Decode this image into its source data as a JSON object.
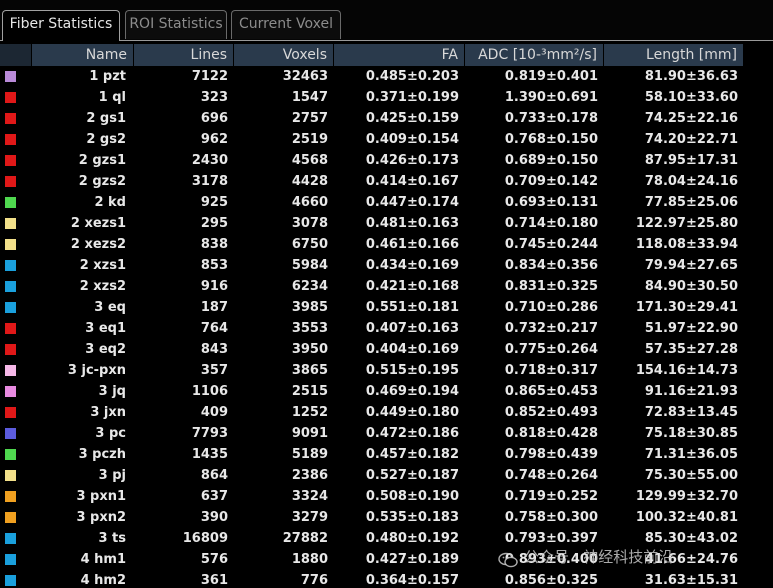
{
  "tabs": [
    {
      "label": "Fiber Statistics",
      "active": true
    },
    {
      "label": "ROI Statistics",
      "active": false
    },
    {
      "label": "Current Voxel",
      "active": false
    }
  ],
  "columns": [
    "Name",
    "Lines",
    "Voxels",
    "FA",
    "ADC  [10-³mm²/s]",
    "Length [mm]"
  ],
  "rows": [
    {
      "color": "#b98ad8",
      "name": "1 pzt",
      "lines": "7122",
      "voxels": "32463",
      "fa": "0.485±0.203",
      "adc": "0.819±0.401",
      "length": "81.90±36.63"
    },
    {
      "color": "#e01818",
      "name": "1 ql",
      "lines": "323",
      "voxels": "1547",
      "fa": "0.371±0.199",
      "adc": "1.390±0.691",
      "length": "58.10±33.60"
    },
    {
      "color": "#e01818",
      "name": "2 gs1",
      "lines": "696",
      "voxels": "2757",
      "fa": "0.425±0.159",
      "adc": "0.733±0.178",
      "length": "74.25±22.16"
    },
    {
      "color": "#e01818",
      "name": "2 gs2",
      "lines": "962",
      "voxels": "2519",
      "fa": "0.409±0.154",
      "adc": "0.768±0.150",
      "length": "74.20±22.71"
    },
    {
      "color": "#e01818",
      "name": "2 gzs1",
      "lines": "2430",
      "voxels": "4568",
      "fa": "0.426±0.173",
      "adc": "0.689±0.150",
      "length": "87.95±17.31"
    },
    {
      "color": "#e01818",
      "name": "2 gzs2",
      "lines": "3178",
      "voxels": "4428",
      "fa": "0.414±0.167",
      "adc": "0.709±0.142",
      "length": "78.04±24.16"
    },
    {
      "color": "#4fd84f",
      "name": "2 kd",
      "lines": "925",
      "voxels": "4660",
      "fa": "0.447±0.174",
      "adc": "0.693±0.131",
      "length": "77.85±25.06"
    },
    {
      "color": "#f2e08a",
      "name": "2 xezs1",
      "lines": "295",
      "voxels": "3078",
      "fa": "0.481±0.163",
      "adc": "0.714±0.180",
      "length": "122.97±25.80"
    },
    {
      "color": "#f2e08a",
      "name": "2 xezs2",
      "lines": "838",
      "voxels": "6750",
      "fa": "0.461±0.166",
      "adc": "0.745±0.244",
      "length": "118.08±33.94"
    },
    {
      "color": "#1aa0dd",
      "name": "2 xzs1",
      "lines": "853",
      "voxels": "5984",
      "fa": "0.434±0.169",
      "adc": "0.834±0.356",
      "length": "79.94±27.65"
    },
    {
      "color": "#1aa0dd",
      "name": "2 xzs2",
      "lines": "916",
      "voxels": "6234",
      "fa": "0.421±0.168",
      "adc": "0.831±0.325",
      "length": "84.90±30.50"
    },
    {
      "color": "#1aa0dd",
      "name": "3 eq",
      "lines": "187",
      "voxels": "3985",
      "fa": "0.551±0.181",
      "adc": "0.710±0.286",
      "length": "171.30±29.41"
    },
    {
      "color": "#e01818",
      "name": "3 eq1",
      "lines": "764",
      "voxels": "3553",
      "fa": "0.407±0.163",
      "adc": "0.732±0.217",
      "length": "51.97±22.90"
    },
    {
      "color": "#e01818",
      "name": "3 eq2",
      "lines": "843",
      "voxels": "3950",
      "fa": "0.404±0.169",
      "adc": "0.775±0.264",
      "length": "57.35±27.28"
    },
    {
      "color": "#f6b8e8",
      "name": "3 jc-pxn",
      "lines": "357",
      "voxels": "3865",
      "fa": "0.515±0.195",
      "adc": "0.718±0.317",
      "length": "154.16±14.73"
    },
    {
      "color": "#e88ae0",
      "name": "3 jq",
      "lines": "1106",
      "voxels": "2515",
      "fa": "0.469±0.194",
      "adc": "0.865±0.453",
      "length": "91.16±21.93"
    },
    {
      "color": "#e01818",
      "name": "3 jxn",
      "lines": "409",
      "voxels": "1252",
      "fa": "0.449±0.180",
      "adc": "0.852±0.493",
      "length": "72.83±13.45"
    },
    {
      "color": "#5c5cde",
      "name": "3 pc",
      "lines": "7793",
      "voxels": "9091",
      "fa": "0.472±0.186",
      "adc": "0.818±0.428",
      "length": "75.18±30.85"
    },
    {
      "color": "#4fd84f",
      "name": "3 pczh",
      "lines": "1435",
      "voxels": "5189",
      "fa": "0.457±0.182",
      "adc": "0.798±0.439",
      "length": "71.31±36.05"
    },
    {
      "color": "#f2e08a",
      "name": "3 pj",
      "lines": "864",
      "voxels": "2386",
      "fa": "0.527±0.187",
      "adc": "0.748±0.264",
      "length": "75.30±55.00"
    },
    {
      "color": "#f0a020",
      "name": "3 pxn1",
      "lines": "637",
      "voxels": "3324",
      "fa": "0.508±0.190",
      "adc": "0.719±0.252",
      "length": "129.99±32.70"
    },
    {
      "color": "#f0a020",
      "name": "3 pxn2",
      "lines": "390",
      "voxels": "3279",
      "fa": "0.535±0.183",
      "adc": "0.758±0.300",
      "length": "100.32±40.81"
    },
    {
      "color": "#1aa0dd",
      "name": "3 ts",
      "lines": "16809",
      "voxels": "27882",
      "fa": "0.480±0.192",
      "adc": "0.793±0.397",
      "length": "85.30±43.02"
    },
    {
      "color": "#1aa0dd",
      "name": "4 hm1",
      "lines": "576",
      "voxels": "1880",
      "fa": "0.427±0.189",
      "adc": "0.893±0.400",
      "length": "41.66±24.76"
    },
    {
      "color": "#1aa0dd",
      "name": "4 hm2",
      "lines": "361",
      "voxels": "776",
      "fa": "0.364±0.157",
      "adc": "0.856±0.325",
      "length": "31.63±15.31"
    }
  ],
  "watermark": "公众号 · 神经科技前沿",
  "icons": {
    "watermark": "wechat-icon"
  }
}
